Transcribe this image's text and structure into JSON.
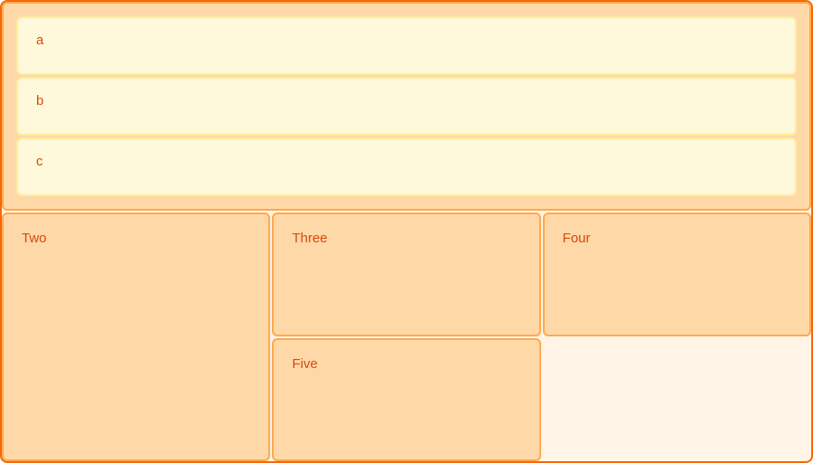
{
  "one": {
    "items": [
      "a",
      "b",
      "c"
    ]
  },
  "boxes": {
    "two": "Two",
    "three": "Three",
    "four": "Four",
    "five": "Five"
  }
}
